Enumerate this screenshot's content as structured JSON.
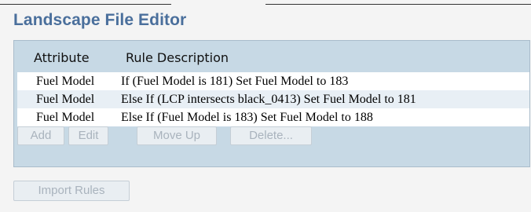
{
  "page_title": "Landscape File Editor",
  "table": {
    "columns": [
      "Attribute",
      "Rule Description"
    ],
    "rows": [
      {
        "attribute": "Fuel Model",
        "description": "If (Fuel Model is 181) Set Fuel Model to 183"
      },
      {
        "attribute": "Fuel Model",
        "description": "Else If (LCP intersects black_0413) Set Fuel Model to 181"
      },
      {
        "attribute": "Fuel Model",
        "description": "Else If (Fuel Model is 183) Set Fuel Model to 188"
      }
    ]
  },
  "toolbar": {
    "add_label": "Add",
    "edit_label": "Edit",
    "move_up_label": "Move Up",
    "delete_label": "Delete..."
  },
  "import_label": "Import Rules",
  "colors": {
    "title": "#4a6f9c",
    "panel": "#c7d9e5",
    "alt_row": "#e8eff5",
    "disabled_text": "#a9b3bd"
  }
}
